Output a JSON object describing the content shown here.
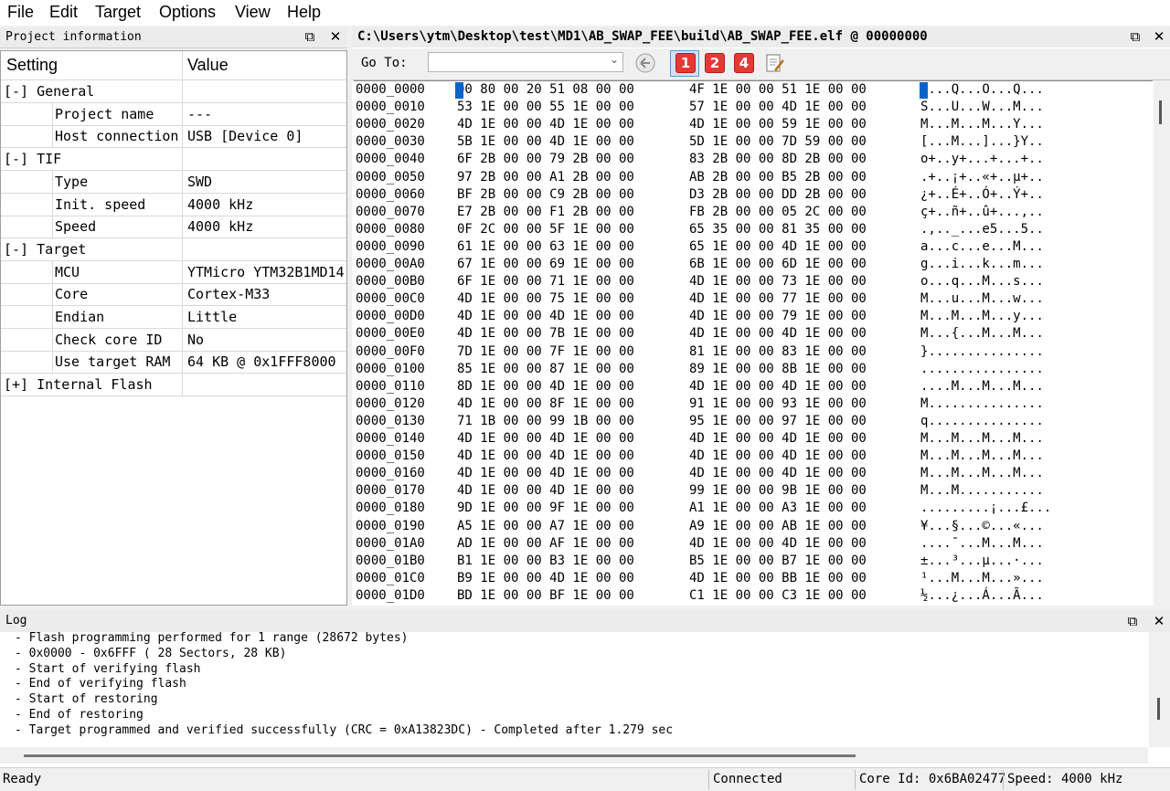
{
  "menu": [
    "File",
    "Edit",
    "Target",
    "Options",
    "View",
    "Help"
  ],
  "project_panel": {
    "title": "Project information",
    "col_setting": "Setting",
    "col_value": "Value",
    "rows": [
      {
        "key": "[-] General",
        "value": "",
        "group": true
      },
      {
        "key": "Project name",
        "value": "---"
      },
      {
        "key": "Host connection",
        "value": "USB [Device 0]"
      },
      {
        "key": "[-] TIF",
        "value": "",
        "group": true
      },
      {
        "key": "Type",
        "value": "SWD"
      },
      {
        "key": "Init. speed",
        "value": "4000 kHz"
      },
      {
        "key": "Speed",
        "value": "4000 kHz"
      },
      {
        "key": "[-] Target",
        "value": "",
        "group": true
      },
      {
        "key": "MCU",
        "value": "YTMicro YTM32B1MD14"
      },
      {
        "key": "Core",
        "value": "Cortex-M33"
      },
      {
        "key": "Endian",
        "value": "Little"
      },
      {
        "key": "Check core ID",
        "value": "No"
      },
      {
        "key": "Use target RAM",
        "value": "64 KB @ 0x1FFF8000"
      },
      {
        "key": "[+] Internal Flash",
        "value": "",
        "group": true
      }
    ]
  },
  "hex_panel": {
    "title": "C:\\Users\\ytm\\Desktop\\test\\MD1\\AB_SWAP_FEE\\build\\AB_SWAP_FEE.elf @ 00000000",
    "goto_label": "Go To:",
    "goto_value": "",
    "toolbar_numbers": [
      "1",
      "2",
      "4"
    ],
    "rows": [
      [
        "0000_0000",
        "00 80 00 20 51 08 00 00",
        "4F 1E 00 00 51 1E 00 00",
        "....Q...O...Q..."
      ],
      [
        "0000_0010",
        "53 1E 00 00 55 1E 00 00",
        "57 1E 00 00 4D 1E 00 00",
        "S...U...W...M..."
      ],
      [
        "0000_0020",
        "4D 1E 00 00 4D 1E 00 00",
        "4D 1E 00 00 59 1E 00 00",
        "M...M...M...Y..."
      ],
      [
        "0000_0030",
        "5B 1E 00 00 4D 1E 00 00",
        "5D 1E 00 00 7D 59 00 00",
        "[...M...]...}Y.."
      ],
      [
        "0000_0040",
        "6F 2B 00 00 79 2B 00 00",
        "83 2B 00 00 8D 2B 00 00",
        "o+..y+...+...+.."
      ],
      [
        "0000_0050",
        "97 2B 00 00 A1 2B 00 00",
        "AB 2B 00 00 B5 2B 00 00",
        ".+..¡+..«+..µ+.."
      ],
      [
        "0000_0060",
        "BF 2B 00 00 C9 2B 00 00",
        "D3 2B 00 00 DD 2B 00 00",
        "¿+..É+..Ó+..Ý+.."
      ],
      [
        "0000_0070",
        "E7 2B 00 00 F1 2B 00 00",
        "FB 2B 00 00 05 2C 00 00",
        "ç+..ñ+..û+...,.."
      ],
      [
        "0000_0080",
        "0F 2C 00 00 5F 1E 00 00",
        "65 35 00 00 81 35 00 00",
        ".,.._...e5...5.."
      ],
      [
        "0000_0090",
        "61 1E 00 00 63 1E 00 00",
        "65 1E 00 00 4D 1E 00 00",
        "a...c...e...M..."
      ],
      [
        "0000_00A0",
        "67 1E 00 00 69 1E 00 00",
        "6B 1E 00 00 6D 1E 00 00",
        "g...i...k...m..."
      ],
      [
        "0000_00B0",
        "6F 1E 00 00 71 1E 00 00",
        "4D 1E 00 00 73 1E 00 00",
        "o...q...M...s..."
      ],
      [
        "0000_00C0",
        "4D 1E 00 00 75 1E 00 00",
        "4D 1E 00 00 77 1E 00 00",
        "M...u...M...w..."
      ],
      [
        "0000_00D0",
        "4D 1E 00 00 4D 1E 00 00",
        "4D 1E 00 00 79 1E 00 00",
        "M...M...M...y..."
      ],
      [
        "0000_00E0",
        "4D 1E 00 00 7B 1E 00 00",
        "4D 1E 00 00 4D 1E 00 00",
        "M...{...M...M..."
      ],
      [
        "0000_00F0",
        "7D 1E 00 00 7F 1E 00 00",
        "81 1E 00 00 83 1E 00 00",
        "}..............."
      ],
      [
        "0000_0100",
        "85 1E 00 00 87 1E 00 00",
        "89 1E 00 00 8B 1E 00 00",
        "................"
      ],
      [
        "0000_0110",
        "8D 1E 00 00 4D 1E 00 00",
        "4D 1E 00 00 4D 1E 00 00",
        "....M...M...M..."
      ],
      [
        "0000_0120",
        "4D 1E 00 00 8F 1E 00 00",
        "91 1E 00 00 93 1E 00 00",
        "M..............."
      ],
      [
        "0000_0130",
        "71 1B 00 00 99 1B 00 00",
        "95 1E 00 00 97 1E 00 00",
        "q..............."
      ],
      [
        "0000_0140",
        "4D 1E 00 00 4D 1E 00 00",
        "4D 1E 00 00 4D 1E 00 00",
        "M...M...M...M..."
      ],
      [
        "0000_0150",
        "4D 1E 00 00 4D 1E 00 00",
        "4D 1E 00 00 4D 1E 00 00",
        "M...M...M...M..."
      ],
      [
        "0000_0160",
        "4D 1E 00 00 4D 1E 00 00",
        "4D 1E 00 00 4D 1E 00 00",
        "M...M...M...M..."
      ],
      [
        "0000_0170",
        "4D 1E 00 00 4D 1E 00 00",
        "99 1E 00 00 9B 1E 00 00",
        "M...M..........."
      ],
      [
        "0000_0180",
        "9D 1E 00 00 9F 1E 00 00",
        "A1 1E 00 00 A3 1E 00 00",
        ".........¡...£..."
      ],
      [
        "0000_0190",
        "A5 1E 00 00 A7 1E 00 00",
        "A9 1E 00 00 AB 1E 00 00",
        "¥...§...©...«..."
      ],
      [
        "0000_01A0",
        "AD 1E 00 00 AF 1E 00 00",
        "4D 1E 00 00 4D 1E 00 00",
        "....¯...M...M..."
      ],
      [
        "0000_01B0",
        "B1 1E 00 00 B3 1E 00 00",
        "B5 1E 00 00 B7 1E 00 00",
        "±...³...µ...·..."
      ],
      [
        "0000_01C0",
        "B9 1E 00 00 4D 1E 00 00",
        "4D 1E 00 00 BB 1E 00 00",
        "¹...M...M...»..."
      ],
      [
        "0000_01D0",
        "BD 1E 00 00 BF 1E 00 00",
        "C1 1E 00 00 C3 1E 00 00",
        "½...¿...Á...Ã..."
      ]
    ]
  },
  "log_panel": {
    "title": "Log",
    "lines": [
      "- Flash programming performed for 1 range (28672 bytes)",
      "- 0x0000 - 0x6FFF ( 28 Sectors, 28 KB)",
      "- Start of verifying flash",
      "- End of verifying flash",
      "- Start of restoring",
      "- End of restoring",
      "- Target programmed and verified successfully (CRC = 0xA13823DC) - Completed after 1.279 sec"
    ]
  },
  "statusbar": {
    "ready": "Ready",
    "connection": "Connected",
    "core_id": "Core Id:  0x6BA02477",
    "speed": "Speed:  4000 kHz"
  },
  "colors": {
    "selection": "#0a64c8",
    "icon_red": "#e53935"
  },
  "icons": [
    "restore-window-icon",
    "close-icon",
    "back-arrow-icon",
    "edit-note-icon",
    "dropdown-chevron-icon"
  ]
}
